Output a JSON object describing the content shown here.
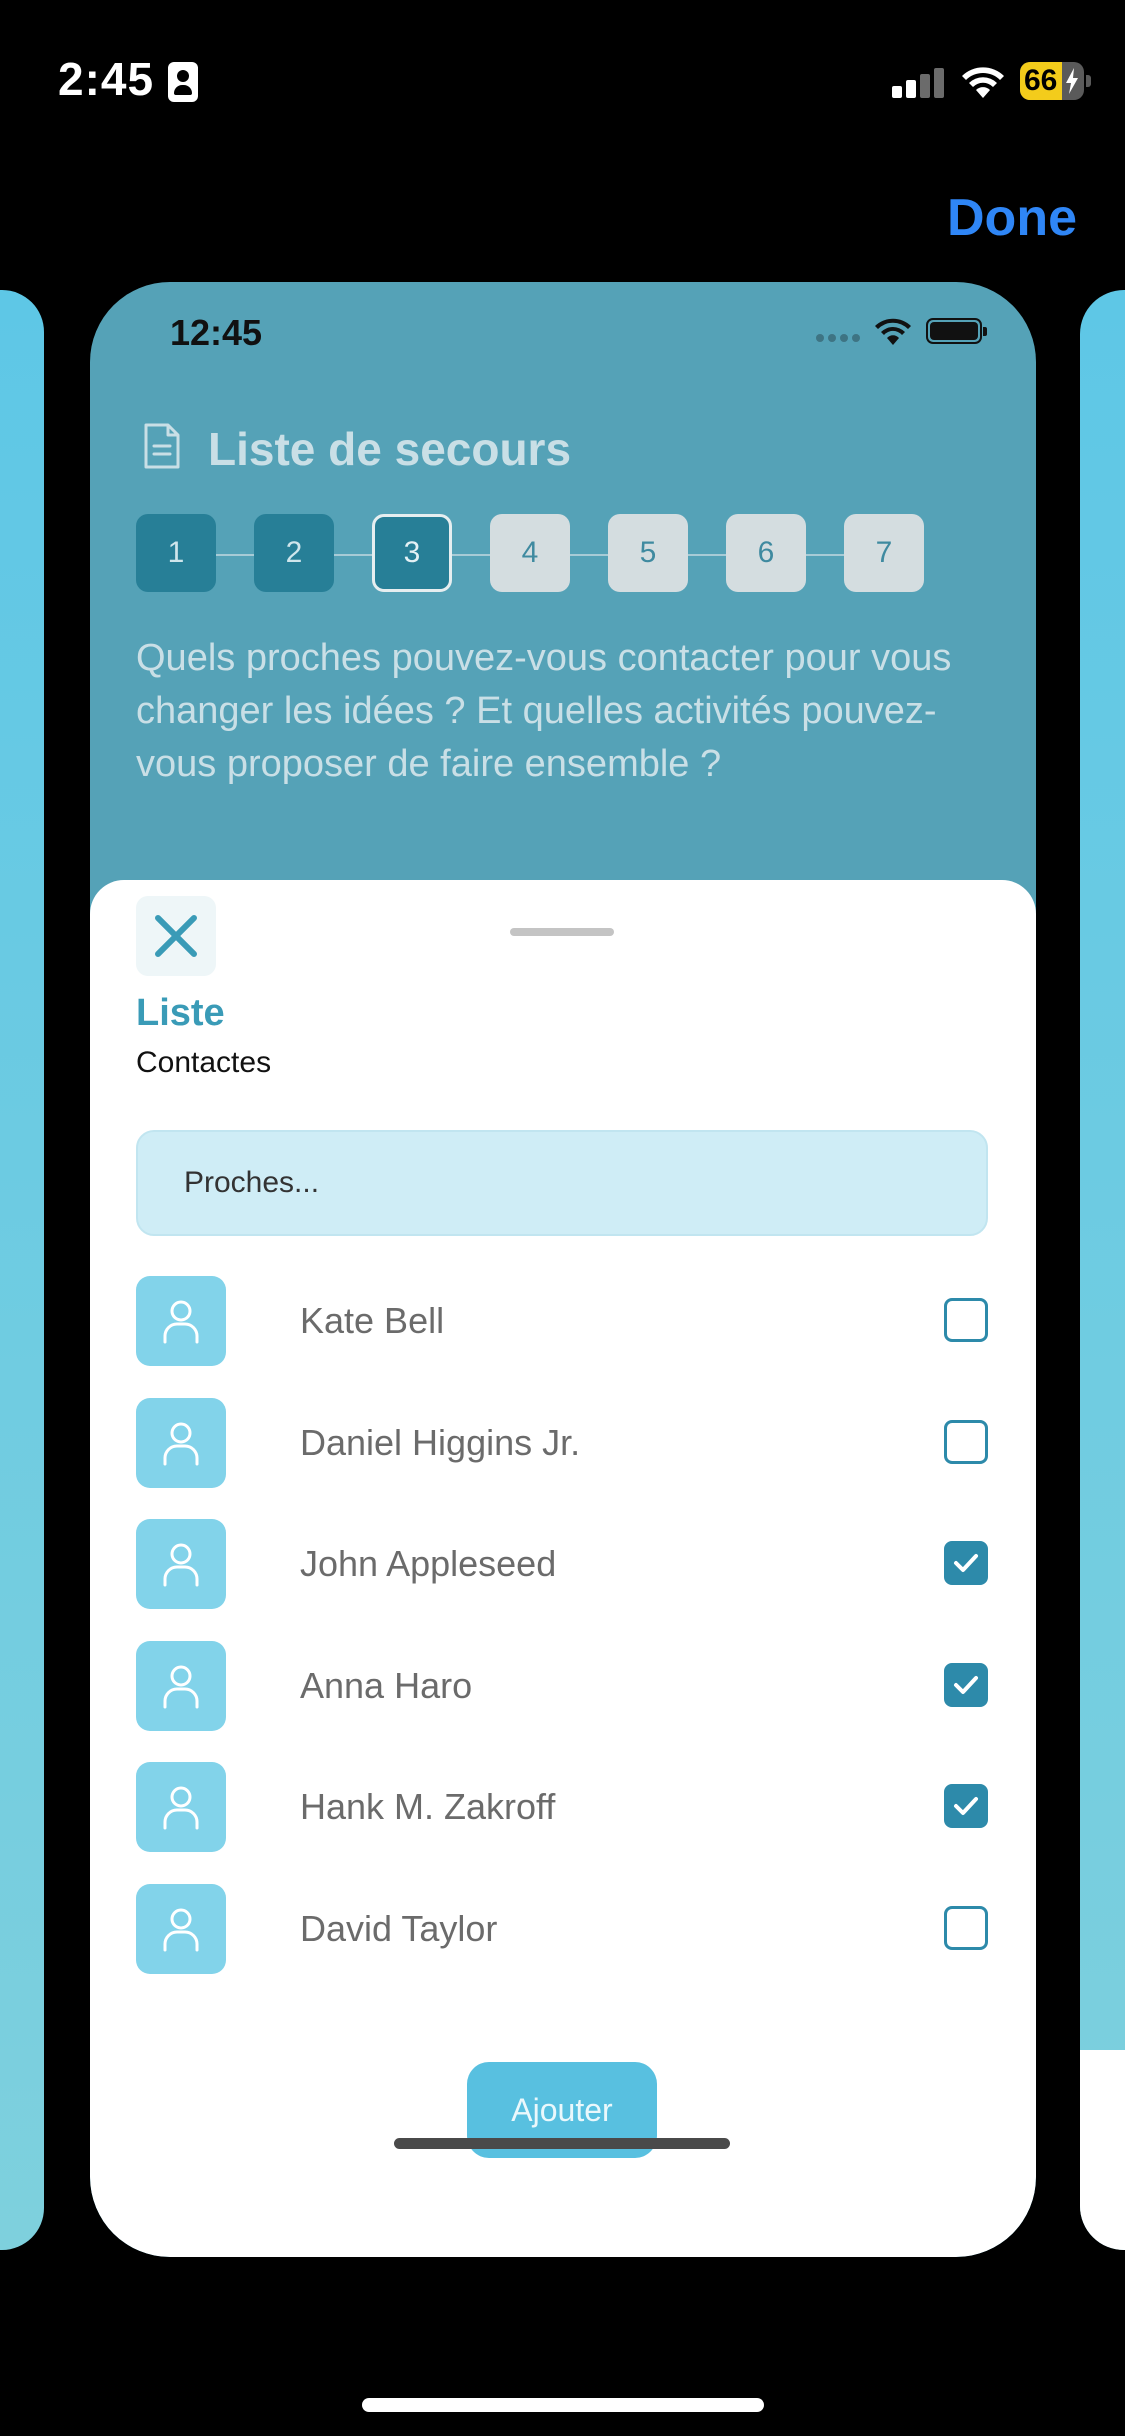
{
  "status_bar": {
    "time": "2:45",
    "battery": "66",
    "battery_level": 0.66
  },
  "header": {
    "done_label": "Done"
  },
  "preview": {
    "status_time": "12:45",
    "title": "Liste de secours",
    "steps": [
      "1",
      "2",
      "3",
      "4",
      "5",
      "6",
      "7"
    ],
    "current_step": 3,
    "question": "Quels proches pouvez-vous contacter pour vous changer les idées ? Et quelles activités pouvez-vous proposer de faire ensemble ?"
  },
  "sheet": {
    "title": "Liste",
    "subtitle": "Contactes",
    "search_placeholder": "Proches...",
    "contacts": [
      {
        "name": "Kate Bell",
        "checked": false
      },
      {
        "name": "Daniel Higgins Jr.",
        "checked": false
      },
      {
        "name": "John Appleseed",
        "checked": true
      },
      {
        "name": "Anna Haro",
        "checked": true
      },
      {
        "name": "Hank M. Zakroff",
        "checked": true
      },
      {
        "name": "David Taylor",
        "checked": false
      }
    ],
    "add_label": "Ajouter"
  },
  "colors": {
    "accent": "#3a9bb7",
    "done_blue": "#2f86f6",
    "avatar_bg": "#82d3ea",
    "checkbox": "#2d8aaa"
  }
}
